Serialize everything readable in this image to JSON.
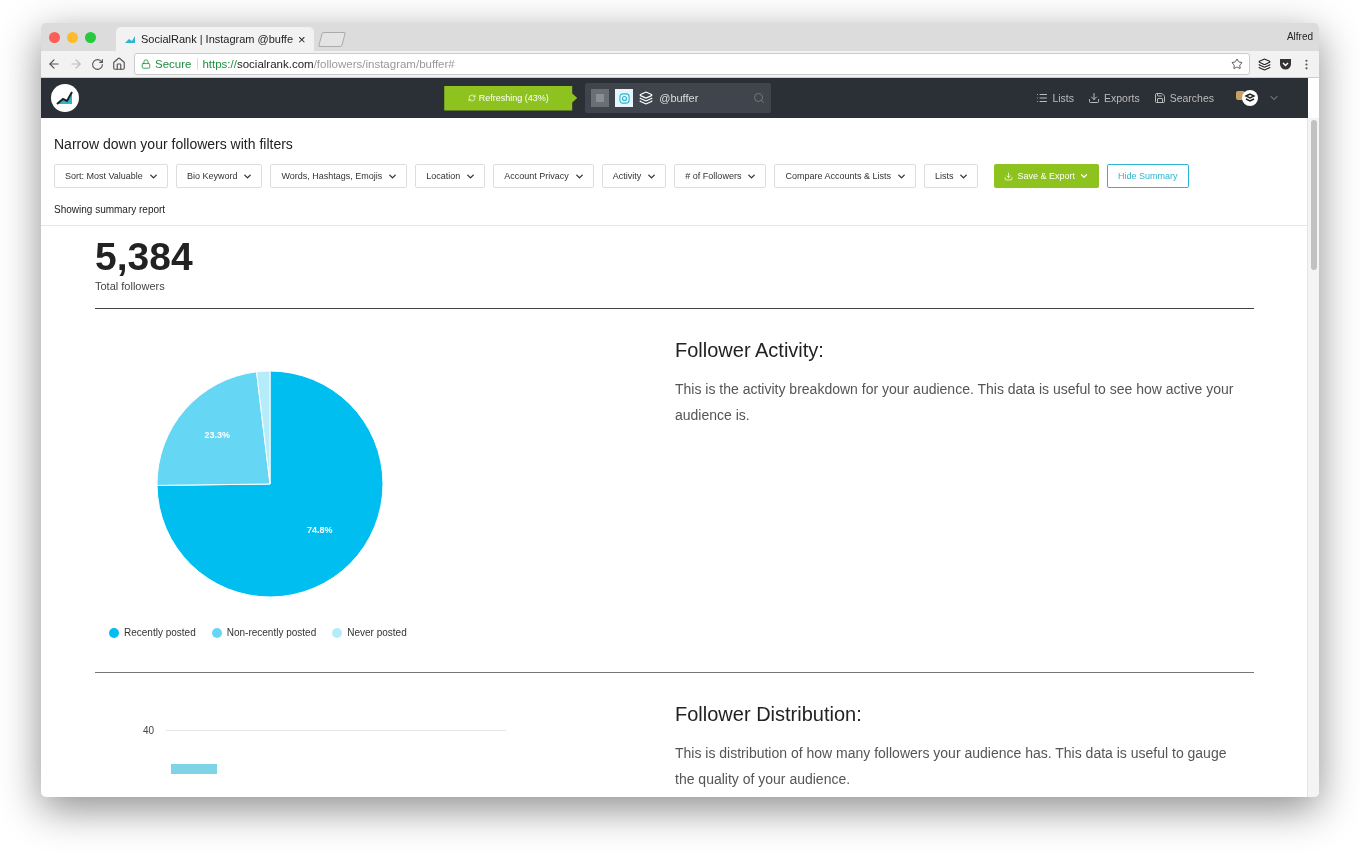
{
  "browser": {
    "tab_title": "SocialRank | Instagram @buffe",
    "tab_close": "×",
    "user": "Alfred",
    "address": {
      "secure_label": "Secure",
      "scheme": "https://",
      "host": "socialrank.com",
      "path": "/followers/instagram/buffer#"
    }
  },
  "navbar": {
    "refresh_button": "Refreshing (43%)",
    "networks": [
      {
        "kind": "twitter",
        "selected": false
      },
      {
        "kind": "instagram",
        "selected": true
      }
    ],
    "search": {
      "value": "@buffer"
    },
    "links": [
      {
        "kind": "lists",
        "label": "Lists"
      },
      {
        "kind": "exports",
        "label": "Exports"
      },
      {
        "kind": "searches",
        "label": "Searches"
      }
    ]
  },
  "filters": {
    "title": "Narrow down your followers with filters",
    "dropdowns": [
      "Sort: Most Valuable",
      "Bio Keyword",
      "Words, Hashtags, Emojis",
      "Location",
      "Account Privacy",
      "Activity",
      "# of Followers",
      "Compare Accounts & Lists",
      "Lists"
    ],
    "save_button": "Save & Export",
    "hide_button": "Hide Summary",
    "status": "Showing summary report"
  },
  "summary": {
    "total": "5,384",
    "total_label": "Total followers"
  },
  "sections": [
    {
      "kind": "pie",
      "title": "Follower Activity:",
      "description": "This is the activity breakdown for your audience. This data is useful to see how active your audience is.",
      "chart_data": {
        "type": "pie",
        "categories": [
          "Recently posted",
          "Non-recently posted",
          "Never posted"
        ],
        "values": [
          74.8,
          23.3,
          1.9
        ],
        "colors": [
          "#00bff0",
          "#66d6f5",
          "#b5ecfa"
        ],
        "value_labels": [
          "74.8%",
          "23.3%",
          null
        ]
      }
    },
    {
      "kind": "distribution",
      "title": "Follower Distribution:",
      "description": "This is distribution of how many followers your audience has. This data is useful to gauge the quality of your audience.",
      "y_tick": "40"
    }
  ]
}
